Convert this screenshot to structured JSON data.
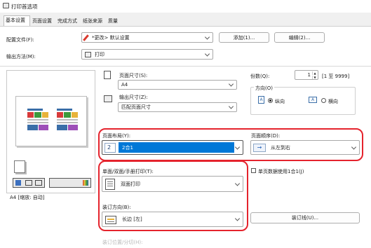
{
  "window": {
    "title": "打印首选项"
  },
  "tabs": [
    "基本设置",
    "页面设置",
    "完成方式",
    "纸张来源",
    "质量"
  ],
  "profile": {
    "label": "配置文件(F):",
    "value": "*更改> 默认设置",
    "add_button": "添加(1)...",
    "edit_button": "编辑(2)..."
  },
  "output": {
    "label": "输出方法(M):",
    "value": "打印"
  },
  "preview": {
    "caption": "A4 [缩放: 自动]"
  },
  "page_size": {
    "label": "页面尺寸(S):",
    "value": "A4"
  },
  "output_size": {
    "label": "输出尺寸(Z):",
    "value": "匹配页面尺寸"
  },
  "copies": {
    "label": "份数(Q):",
    "value": "1",
    "range": "[1 至 9999]"
  },
  "orientation": {
    "label": "方向(O)",
    "portrait": "纵向",
    "landscape": "横向",
    "selected": "portrait"
  },
  "layout": {
    "label": "页面布局(Y):",
    "value": "2合1",
    "icon_number": "2"
  },
  "page_order": {
    "label": "页面顺序(D):",
    "value": "从左到右"
  },
  "duplex": {
    "label": "单面/双面/手册打印(T):",
    "value": "双面打印"
  },
  "single_page_checkbox": {
    "label": "单页数据使用1合1(J)"
  },
  "binding": {
    "label": "装订方向(B):",
    "value": "长边 [左]",
    "gutter_button": "装订线(U)..."
  },
  "cutoff": {
    "label": "装订位置/分切(H):"
  },
  "colors": {
    "accent": "#0078d7",
    "highlight": "#e5232d"
  }
}
